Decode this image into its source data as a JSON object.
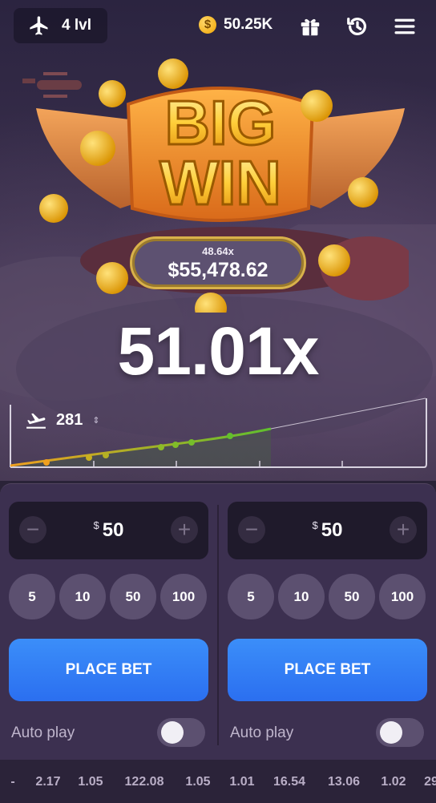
{
  "topbar": {
    "level_label": "4 lvl",
    "balance": "50.25K",
    "coin_symbol": "$",
    "icons": [
      "plane-icon",
      "coin-icon",
      "gift-icon",
      "history-icon",
      "menu-icon"
    ]
  },
  "big_win": {
    "line1": "BIG",
    "line2": "WIN",
    "multiplier": "48.64x",
    "amount": "$55,478.62"
  },
  "current_multiplier": "51.01x",
  "graph": {
    "players_count": "281",
    "sort_glyph": "⇕"
  },
  "bets": [
    {
      "currency": "$",
      "amount": "50",
      "minus": "−",
      "plus": "+",
      "quick": [
        "5",
        "10",
        "50",
        "100"
      ],
      "place_label": "PLACE BET",
      "auto_label": "Auto play",
      "auto_on": false
    },
    {
      "currency": "$",
      "amount": "50",
      "minus": "−",
      "plus": "+",
      "quick": [
        "5",
        "10",
        "50",
        "100"
      ],
      "place_label": "PLACE BET",
      "auto_label": "Auto play",
      "auto_on": false
    }
  ],
  "history": [
    "-",
    "2.17",
    "1.05",
    "122.08",
    "1.05",
    "1.01",
    "16.54",
    "13.06",
    "1.02",
    "29"
  ],
  "colors": {
    "accent_blue": "#2f7df5",
    "gold": "#f4b72a",
    "panel": "#3c3050",
    "curve_start": "#f0a020",
    "curve_end": "#5fbf2e"
  }
}
